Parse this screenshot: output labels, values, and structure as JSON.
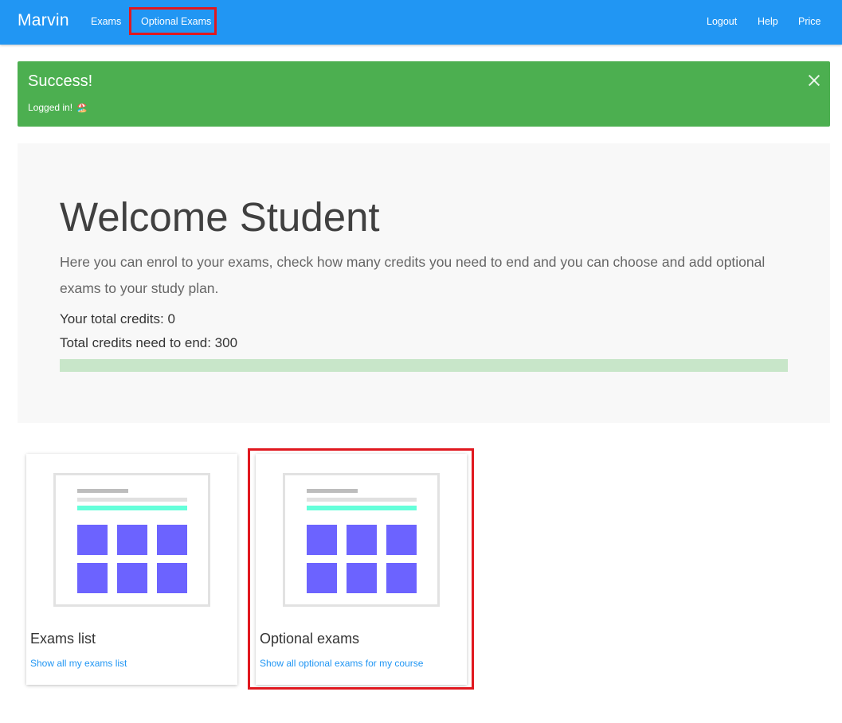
{
  "navbar": {
    "brand": "Marvin",
    "left_links": [
      {
        "label": "Exams"
      },
      {
        "label": "Optional Exams",
        "highlighted": true
      }
    ],
    "right_links": [
      {
        "label": "Logout"
      },
      {
        "label": "Help"
      },
      {
        "label": "Price"
      }
    ]
  },
  "alert": {
    "title": "Success!",
    "message": "Logged in!",
    "emoji": "🏖️",
    "close_icon": "close-icon"
  },
  "jumbotron": {
    "title": "Welcome Student",
    "lead": "Here you can enrol to your exams, check how many credits you need to end and you can choose and add optional exams to your study plan.",
    "credits_total": "Your total credits: 0",
    "credits_needed": "Total credits need to end: 300",
    "progress_fraction": 0
  },
  "cards": [
    {
      "title": "Exams list",
      "link": "Show all my exams list",
      "illustration_icon": "dashboard-illustration"
    },
    {
      "title": "Optional exams",
      "link": "Show all optional exams for my course",
      "illustration_icon": "dashboard-illustration",
      "highlighted": true
    }
  ],
  "colors": {
    "navbar": "#2196f3",
    "success": "#4caf50",
    "progress_track": "#c8e6c9",
    "illustration_accent": "#6c63ff",
    "illustration_line": "#64ffda",
    "link": "#2196f3",
    "highlight": "#e0181f"
  }
}
